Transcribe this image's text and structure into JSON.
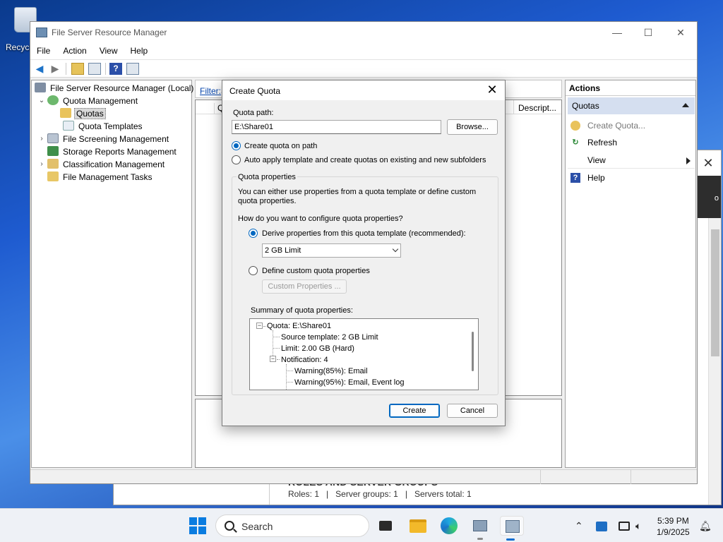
{
  "desktop": {
    "recycle_label": "Recycl"
  },
  "background_window": {
    "close_glyph": "✕",
    "strip_text": "o",
    "roles_heading": "ROLES AND SERVER GROUPS",
    "roles_summary": "Roles: 1   |   Server groups: 1   |   Servers total: 1"
  },
  "main_window": {
    "title": "File Server Resource Manager",
    "controls": {
      "minimize": "—",
      "maximize": "☐",
      "close": "✕"
    },
    "menu": [
      "File",
      "Action",
      "View",
      "Help"
    ],
    "tree": {
      "root": "File Server Resource Manager (Local)",
      "quota_management": "Quota Management",
      "quotas": "Quotas",
      "quota_templates": "Quota Templates",
      "file_screening": "File Screening Management",
      "storage_reports": "Storage Reports Management",
      "classification": "Classification Management",
      "file_mgmt_tasks": "File Management Tasks"
    },
    "center": {
      "filter_label": "Filter:",
      "filter_value": "S",
      "col_first": "Q",
      "col_description": "Descript..."
    },
    "actions": {
      "header": "Actions",
      "section": "Quotas",
      "items": [
        {
          "label": "Create Quota...",
          "icon": "quota-icon"
        },
        {
          "label": "Refresh",
          "icon": "refresh-icon"
        },
        {
          "label": "View",
          "icon": ""
        },
        {
          "label": "Help",
          "icon": "help-icon"
        }
      ]
    }
  },
  "dialog": {
    "title": "Create Quota",
    "close_glyph": "✕",
    "quota_path_label": "Quota path:",
    "quota_path_value": "E:\\Share01",
    "browse_label": "Browse...",
    "radio_create": "Create quota on path",
    "radio_auto": "Auto apply template and create quotas on existing and new subfolders",
    "group_title": "Quota properties",
    "group_desc_1": "You can either use properties from a quota template or define custom",
    "group_desc_2": "quota properties.",
    "how_label": "How do you want to configure quota properties?",
    "radio_derive": "Derive properties from this quota template (recommended):",
    "template_selected": "2 GB Limit",
    "radio_custom": "Define custom quota properties",
    "custom_button": "Custom Properties ...",
    "summary_label": "Summary of quota properties:",
    "summary": {
      "quota": "Quota: E:\\Share01",
      "source": "Source template: 2 GB Limit",
      "limit": "Limit: 2.00 GB (Hard)",
      "notification": "Notification: 4",
      "warn85": "Warning(85%): Email",
      "warn95": "Warning(95%): Email, Event log"
    },
    "create_label": "Create",
    "cancel_label": "Cancel"
  },
  "taskbar": {
    "search_label": "Search",
    "time": "5:39 PM",
    "date": "1/9/2025"
  },
  "colors": {
    "accent": "#0067c0",
    "selection": "#d5dff0",
    "link": "#0645ad"
  }
}
